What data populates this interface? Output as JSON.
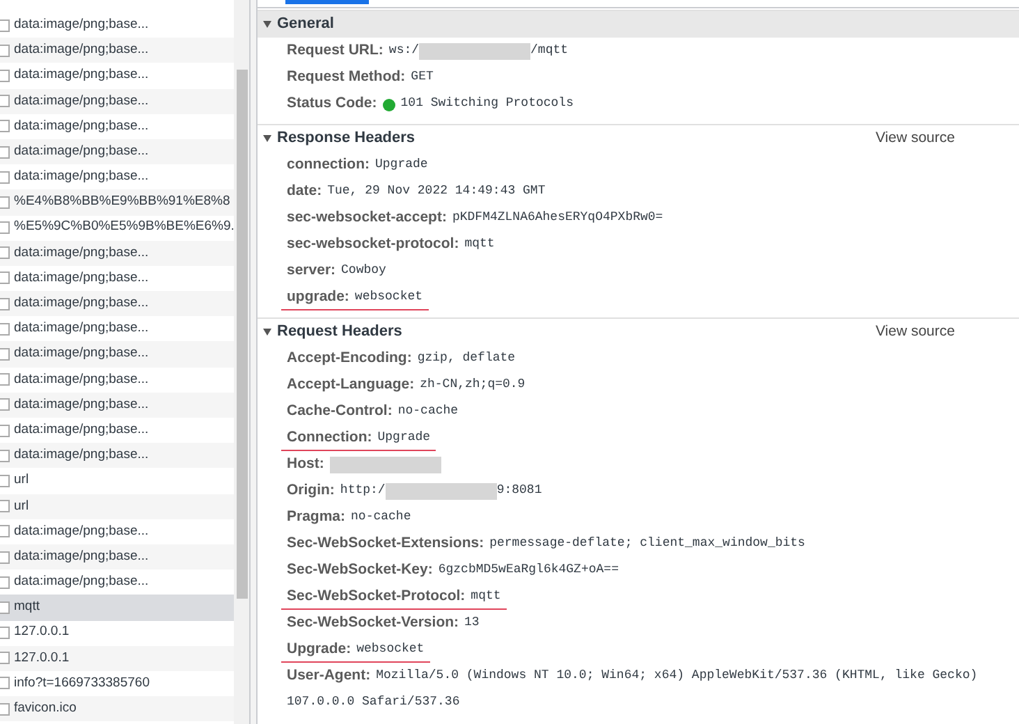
{
  "requests": [
    {
      "name": "data:image/png;base...",
      "selected": false
    },
    {
      "name": "data:image/png;base...",
      "selected": false
    },
    {
      "name": "data:image/png;base...",
      "selected": false
    },
    {
      "name": "data:image/png;base...",
      "selected": false
    },
    {
      "name": "data:image/png;base...",
      "selected": false
    },
    {
      "name": "data:image/png;base...",
      "selected": false
    },
    {
      "name": "data:image/png;base...",
      "selected": false
    },
    {
      "name": "%E4%B8%BB%E9%BB%91%E8%8",
      "selected": false
    },
    {
      "name": "%E5%9C%B0%E5%9B%BE%E6%9.",
      "selected": false
    },
    {
      "name": "data:image/png;base...",
      "selected": false
    },
    {
      "name": "data:image/png;base...",
      "selected": false
    },
    {
      "name": "data:image/png;base...",
      "selected": false
    },
    {
      "name": "data:image/png;base...",
      "selected": false
    },
    {
      "name": "data:image/png;base...",
      "selected": false
    },
    {
      "name": "data:image/png;base...",
      "selected": false
    },
    {
      "name": "data:image/png;base...",
      "selected": false
    },
    {
      "name": "data:image/png;base...",
      "selected": false
    },
    {
      "name": "data:image/png;base...",
      "selected": false
    },
    {
      "name": "url",
      "selected": false
    },
    {
      "name": "url",
      "selected": false
    },
    {
      "name": "data:image/png;base...",
      "selected": false
    },
    {
      "name": "data:image/png;base...",
      "selected": false
    },
    {
      "name": "data:image/png;base...",
      "selected": false
    },
    {
      "name": "mqtt",
      "selected": true
    },
    {
      "name": "127.0.0.1",
      "selected": false
    },
    {
      "name": "127.0.0.1",
      "selected": false
    },
    {
      "name": "info?t=1669733385760",
      "selected": false
    },
    {
      "name": "favicon.ico",
      "selected": false
    }
  ],
  "sections": [
    {
      "title": "General",
      "expanded": true,
      "shaded": true,
      "rows": [
        {
          "key": "Request URL:",
          "value": [
            {
              "text": "ws:/"
            },
            {
              "kind": "redacted"
            },
            {
              "text": "/mqtt"
            }
          ],
          "underlined": false
        },
        {
          "key": "Request Method:",
          "value": [
            {
              "text": "GET"
            }
          ],
          "underlined": false
        },
        {
          "key": "Status Code:",
          "status_dot": true,
          "value": [
            {
              "text": "101 Switching Protocols"
            }
          ],
          "underlined": false
        }
      ]
    },
    {
      "title": "Response Headers",
      "expanded": true,
      "shaded": false,
      "link": "View source",
      "rows": [
        {
          "key": "connection:",
          "value": [
            {
              "text": "Upgrade"
            }
          ],
          "underlined": false
        },
        {
          "key": "date:",
          "value": [
            {
              "text": "Tue, 29 Nov 2022 14:49:43 GMT"
            }
          ],
          "underlined": false
        },
        {
          "key": "sec-websocket-accept:",
          "value": [
            {
              "text": "pKDFM4ZLNA6AhesERYqO4PXbRw0="
            }
          ],
          "underlined": false
        },
        {
          "key": "sec-websocket-protocol:",
          "value": [
            {
              "text": "mqtt"
            }
          ],
          "underlined": false
        },
        {
          "key": "server:",
          "value": [
            {
              "text": "Cowboy"
            }
          ],
          "underlined": false
        },
        {
          "key": "upgrade:",
          "value": [
            {
              "text": "websocket"
            }
          ],
          "underlined": true
        }
      ]
    },
    {
      "title": "Request Headers",
      "expanded": true,
      "shaded": false,
      "link": "View source",
      "rows": [
        {
          "key": "Accept-Encoding:",
          "value": [
            {
              "text": "gzip, deflate"
            }
          ],
          "underlined": false
        },
        {
          "key": "Accept-Language:",
          "value": [
            {
              "text": "zh-CN,zh;q=0.9"
            }
          ],
          "underlined": false
        },
        {
          "key": "Cache-Control:",
          "value": [
            {
              "text": "no-cache"
            }
          ],
          "underlined": false
        },
        {
          "key": "Connection:",
          "value": [
            {
              "text": "Upgrade"
            }
          ],
          "underlined": true
        },
        {
          "key": "Host:",
          "value": [
            {
              "kind": "redacted"
            }
          ],
          "underlined": false
        },
        {
          "key": "Origin:",
          "value": [
            {
              "text": "http:/"
            },
            {
              "kind": "redacted"
            },
            {
              "text": "9:8081"
            }
          ],
          "underlined": false
        },
        {
          "key": "Pragma:",
          "value": [
            {
              "text": "no-cache"
            }
          ],
          "underlined": false
        },
        {
          "key": "Sec-WebSocket-Extensions:",
          "value": [
            {
              "text": "permessage-deflate; client_max_window_bits"
            }
          ],
          "underlined": false
        },
        {
          "key": "Sec-WebSocket-Key:",
          "value": [
            {
              "text": "6gzcbMD5wEaRgl6k4GZ+oA=="
            }
          ],
          "underlined": false
        },
        {
          "key": "Sec-WebSocket-Protocol:",
          "value": [
            {
              "text": "mqtt"
            }
          ],
          "underlined": true
        },
        {
          "key": "Sec-WebSocket-Version:",
          "value": [
            {
              "text": "13"
            }
          ],
          "underlined": false
        },
        {
          "key": "Upgrade:",
          "value": [
            {
              "text": "websocket"
            }
          ],
          "underlined": true
        },
        {
          "key": "User-Agent:",
          "value": [
            {
              "text": "Mozilla/5.0 (Windows NT 10.0; Win64; x64) AppleWebKit/537.36 (KHTML, like Gecko)"
            }
          ],
          "underlined": false
        },
        {
          "key": "",
          "value": [
            {
              "text": "107.0.0.0 Safari/537.36"
            }
          ],
          "underlined": false
        }
      ]
    }
  ]
}
